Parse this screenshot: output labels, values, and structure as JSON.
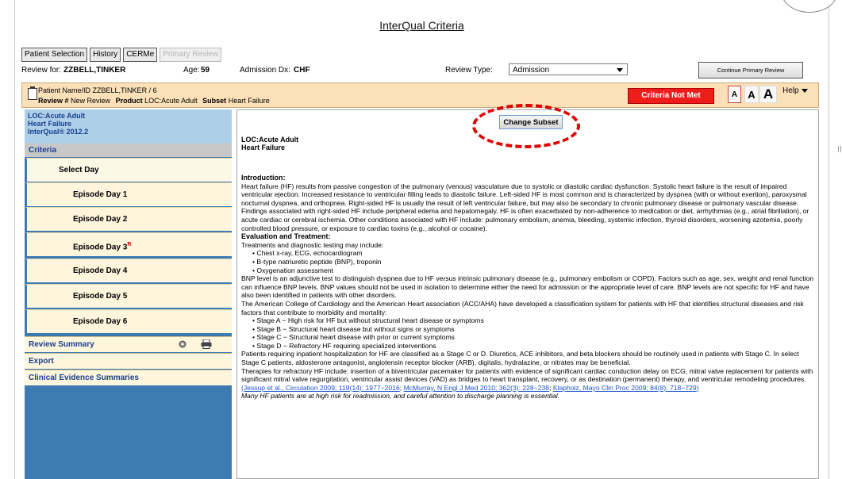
{
  "app": {
    "title": "InterQual Criteria"
  },
  "tabs": [
    {
      "label": "Patient Selection",
      "enabled": true
    },
    {
      "label": "History",
      "enabled": true
    },
    {
      "label": "CERMe",
      "enabled": true
    },
    {
      "label": "Primary Review",
      "enabled": false
    }
  ],
  "review": {
    "for_label": "Review for:",
    "patient": "ZZBELL,TINKER",
    "age_label": "Age:",
    "age": "59",
    "dx_label": "Admission Dx:",
    "dx": "CHF",
    "type_label": "Review Type:",
    "type_value": "Admission",
    "continue_label": "Continue Primary Review"
  },
  "patient_bar": {
    "name_label": "Patient Name/ID",
    "name_value": "ZZBELL,TINKER / 6",
    "review_label": "Review #",
    "review_value": "New Review",
    "product_label": "Product",
    "product_value": "LOC:Acute Adult",
    "subset_label": "Subset",
    "subset_value": "Heart Failure",
    "status": "Criteria Not Met",
    "font_small": "A",
    "font_medium": "A",
    "font_large": "A",
    "help": "Help"
  },
  "sidebar": {
    "header_line1": "LOC:Acute Adult",
    "header_line2": "Heart Failure",
    "header_line3": "InterQual® 2012.2",
    "criteria": "Criteria",
    "days": [
      {
        "label": "Select Day"
      },
      {
        "label": "Episode Day 1"
      },
      {
        "label": "Episode Day 2"
      },
      {
        "label": "Episode Day 3",
        "marker": "R"
      },
      {
        "label": "Episode Day 4"
      },
      {
        "label": "Episode Day 5"
      },
      {
        "label": "Episode Day 6"
      }
    ],
    "review_summary": "Review Summary",
    "export": "Export",
    "clinical": "Clinical Evidence Summaries"
  },
  "content": {
    "change_subset": "Change Subset",
    "loc": "LOC:Acute Adult",
    "subset": "Heart Failure",
    "intro_heading": "Introduction:",
    "intro_text": "Heart failure (HF) results from passive congestion of the pulmonary (venous) vasculature due to systolic or diastolic cardiac dysfunction. Systolic heart failure is the result of impaired ventricular ejection. Increased resistance to ventricular filling leads to diastolic failure. Left-sided HF is most common and is characterized by dyspnea (with or without exertion), paroxysmal nocturnal dyspnea, and orthopnea. Right-sided HF is usually the result of left ventricular failure, but may also be secondary to chronic pulmonary disease or pulmonary vascular disease. Findings associated with right-sided HF include peripheral edema and hepatomegaly. HF is often exacerbated by non-adherence to medication or diet, arrhythmias (e.g., atrial fibrillation), or acute cardiac or cerebral ischemia. Other conditions associated with HF include: pulmonary embolism, anemia, bleeding, systemic infection, thyroid disorders, worsening azotemia, poorly controlled blood pressure, or exposure to cardiac toxins (e.g., alcohol or cocaine).",
    "eval_heading": "Evaluation and Treatment:",
    "eval_text": "Treatments and diagnostic testing may include:",
    "eval_bullets": [
      "• Chest x-ray, ECG, echocardiogram",
      "• B-type natriuretic peptide (BNP), troponin",
      "• Oxygenation assessment"
    ],
    "bnp_text": "BNP level is an adjunctive test to distinguish dyspnea due to HF versus intrinsic pulmonary disease (e.g., pulmonary embolism or COPD). Factors such as age, sex, weight and renal function can influence BNP levels. BNP values should not be used in isolation to determine either the need for admission or the appropriate level of care. BNP levels are not specific for HF and have also been identified in patients with other disorders.",
    "acc_text": "The American College of Cardiology and the American Heart association (ACC/AHA) have developed a classification system for patients with HF that identifies structural diseases and risk factors that contribute to morbidity and mortality:",
    "stages": [
      "• Stage A − High risk for HF but without structural heart disease or symptoms",
      "• Stage B − Structural heart disease but without signs or symptoms",
      "• Stage C − Structural heart disease with prior or current symptoms",
      "• Stage D − Refractory HF requiring specialized interventions"
    ],
    "stage_text": "Patients requiring inpatient hospitalization for HF are classified as a Stage C or D. Diuretics, ACE inhibitors, and beta blockers should be routinely used in patients with Stage C. In select Stage C patients, aldosterone antagonist, angiotensin receptor blocker (ARB), digitalis, hydralazine, or nitrates may be beneficial.",
    "therapy_text": "Therapies for refractory HF include: insertion of a biventricular pacemaker for patients with evidence of significant cardiac conduction delay on ECG, mitral valve replacement for patients with significant mitral valve regurgitation, ventricular assist devices (VAD) as bridges to heart transplant, recovery, or as destination (permanent) therapy, and ventricular remodeling procedures.",
    "ref1": "(Jessup et al., Circulation 2009; 119(14): 1977−2016",
    "ref2": "McMurray, N Engl J Med 2010; 362(3): 228−238",
    "ref3": "Klapholz, Mayo Clin Proc 2009; 84(8): 718−729",
    "ref_sep": "; ",
    "ref_end": ")",
    "closing": "Many HF patients are at high risk for readmission, and careful attention to discharge planning is essential."
  },
  "colors": {
    "accent_red": "#ef1c1c",
    "sidebar_blue": "#3f7bb3",
    "patient_bar_bg": "#fbe0b8"
  }
}
